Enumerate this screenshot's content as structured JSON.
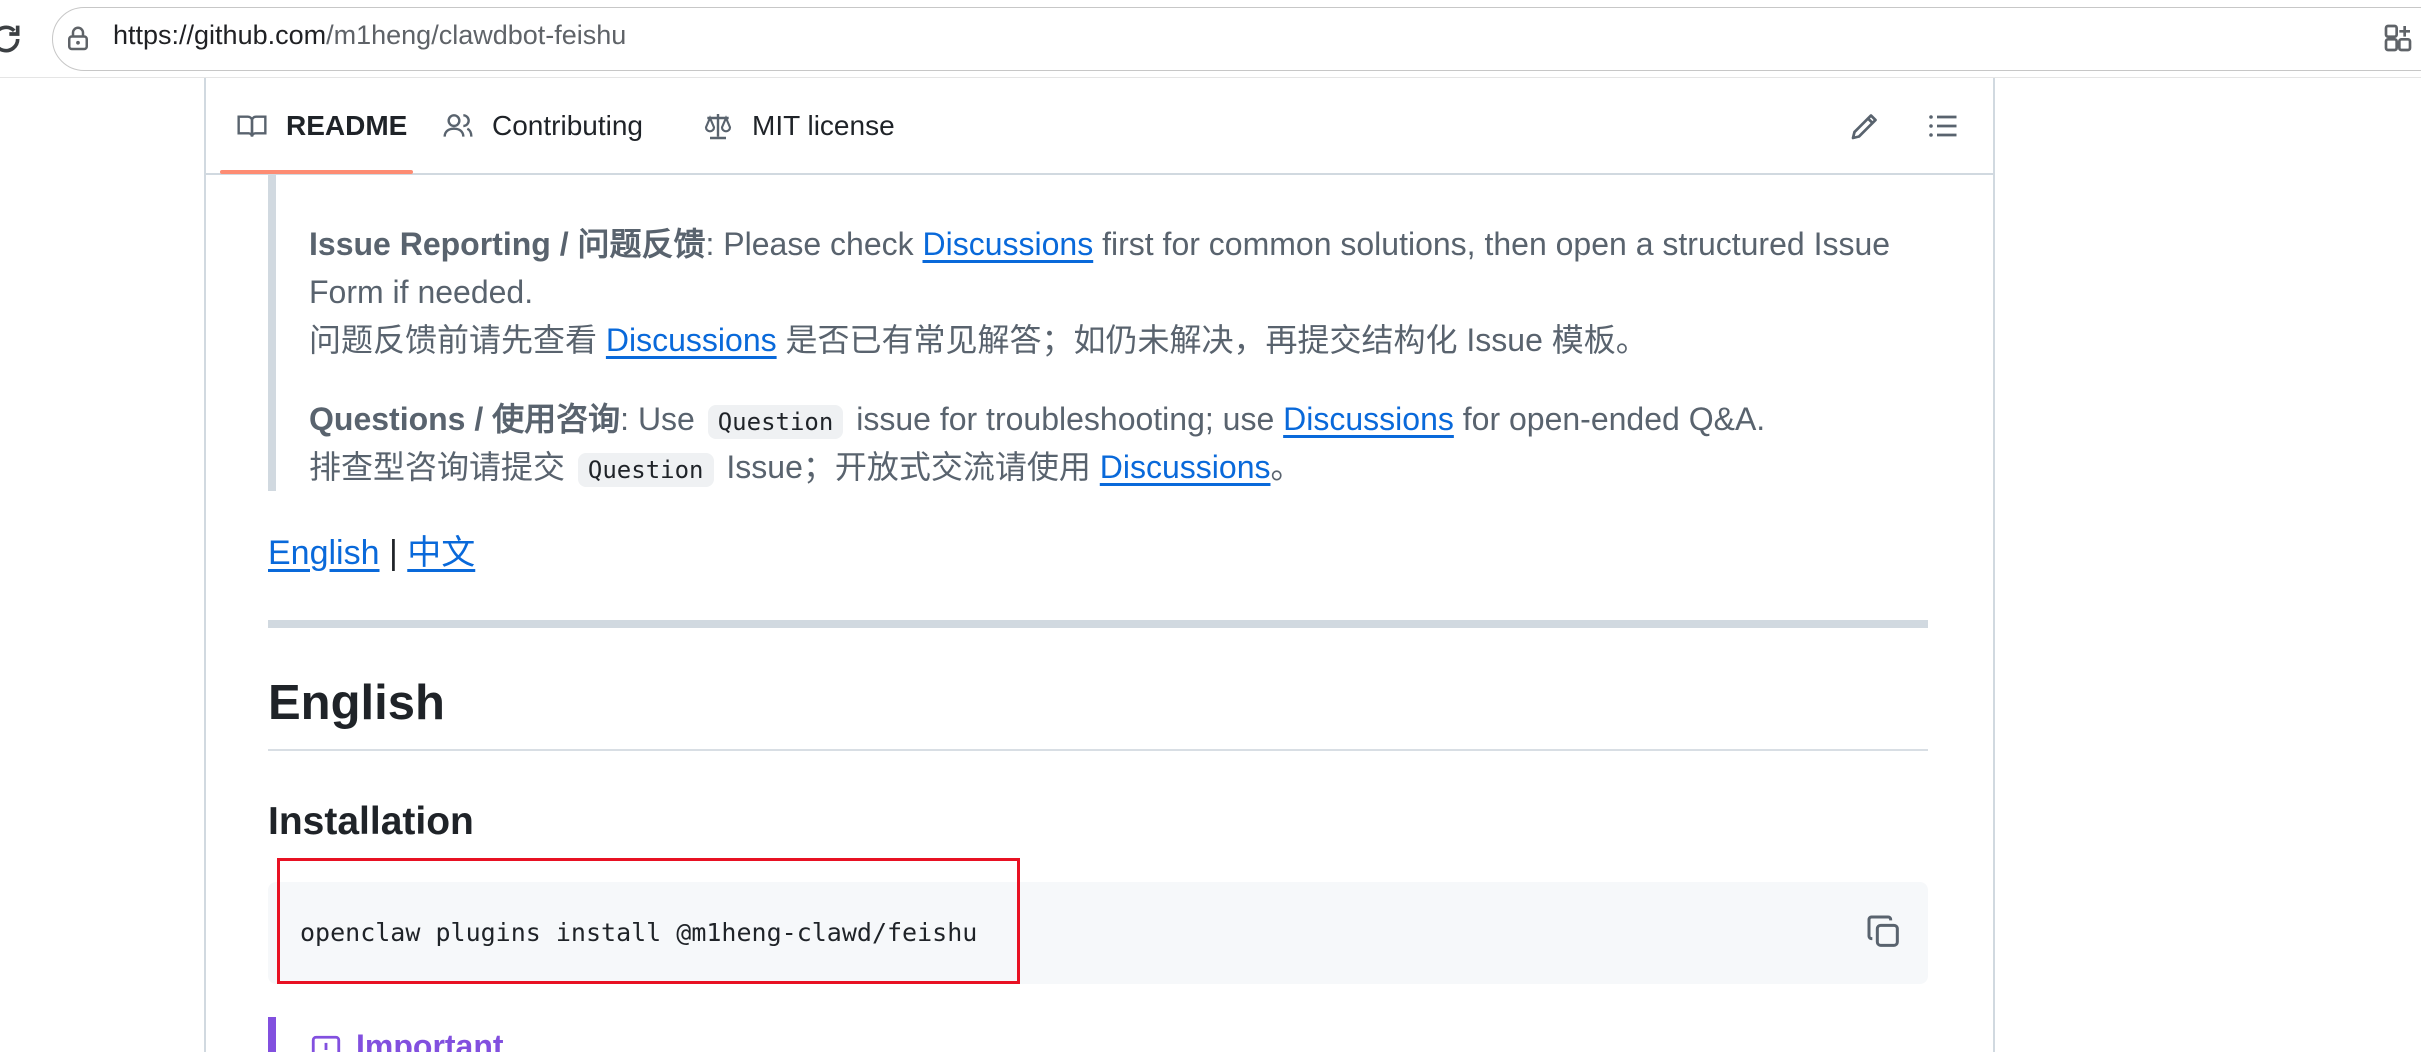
{
  "browser": {
    "url_host": "https://github.com",
    "url_path": "/m1heng/clawdbot-feishu"
  },
  "tabs": [
    {
      "label": "README",
      "icon": "book-icon",
      "active": true
    },
    {
      "label": "Contributing",
      "icon": "people-icon",
      "active": false
    },
    {
      "label": "MIT license",
      "icon": "law-icon",
      "active": false
    }
  ],
  "toolbar": {
    "edit_icon": "pencil-icon",
    "outline_icon": "list-icon"
  },
  "readme": {
    "issue": {
      "label": "Issue Reporting / 问题反馈",
      "text_before": ": Please check ",
      "link": "Discussions",
      "text_after": " first for common solutions, then open a structured Issue",
      "line2": "Form if needed.",
      "zh_before": "问题反馈前请先查看 ",
      "zh_link": "Discussions",
      "zh_after": " 是否已有常见解答；如仍未解决，再提交结构化 Issue 模板。"
    },
    "questions": {
      "label": "Questions / 使用咨询",
      "text_before": ": Use ",
      "code": "Question",
      "text_mid": " issue for troubleshooting; use ",
      "link": "Discussions",
      "text_after": " for open-ended Q&A.",
      "zh_before": "排查型咨询请提交 ",
      "zh_code": "Question",
      "zh_mid": " Issue；开放式交流请使用 ",
      "zh_link": "Discussions",
      "zh_after": "。"
    },
    "lang_links": {
      "english": "English",
      "separator": " | ",
      "chinese": "中文"
    },
    "heading_english": "English",
    "heading_installation": "Installation",
    "install_command": "openclaw plugins install @m1heng-clawd/feishu",
    "important_label": "Important"
  },
  "colors": {
    "link": "#0969da",
    "tab_underline": "#fd8c73",
    "highlight_box": "#e81123",
    "important": "#8250df"
  }
}
